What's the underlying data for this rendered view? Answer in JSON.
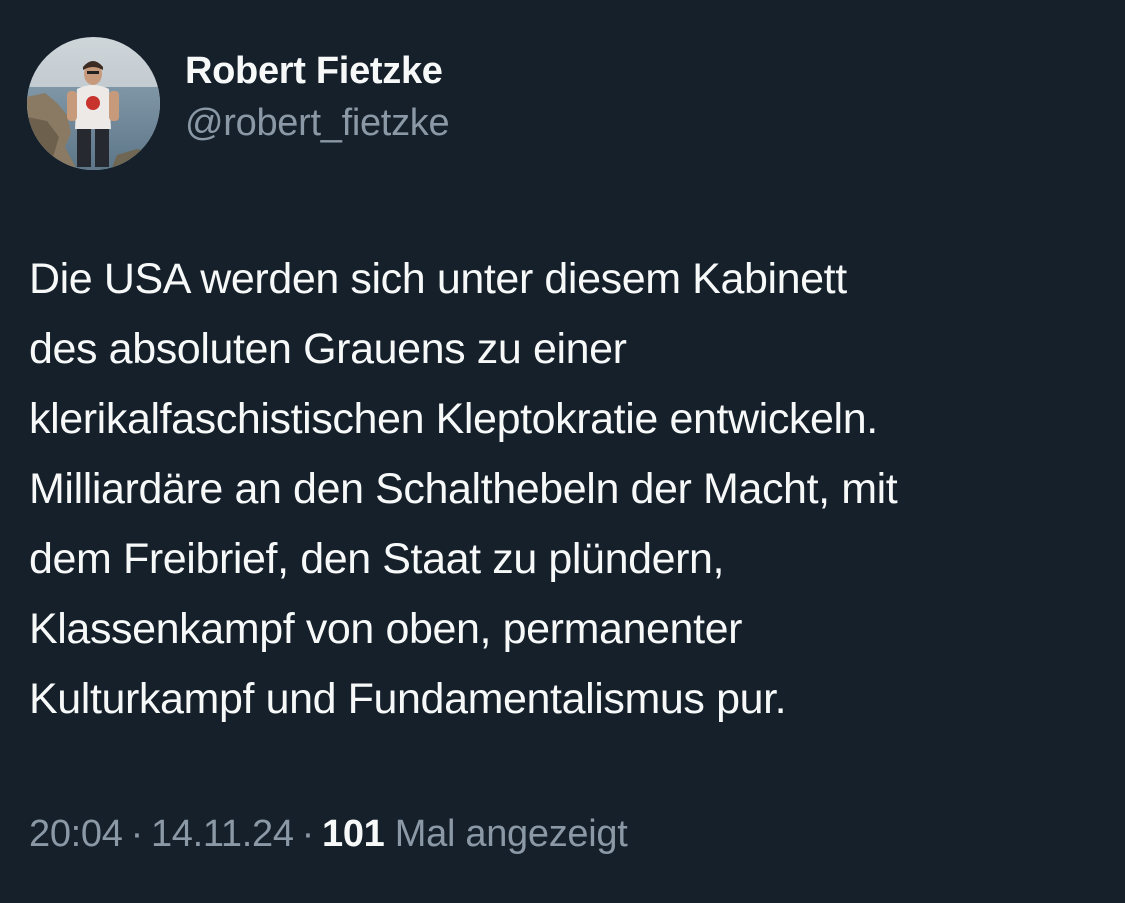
{
  "author": {
    "display_name": "Robert Fietzke",
    "handle": "@robert_fietzke",
    "avatar_icon": "profile-photo"
  },
  "tweet": {
    "lines": [
      "Die USA werden sich unter diesem Kabinett",
      "des absoluten Grauens zu einer",
      "klerikalfaschistischen Kleptokratie entwickeln.",
      "Milliardäre an den Schalthebeln der Macht, mit",
      "dem Freibrief, den Staat zu plündern,",
      "Klassenkampf von oben, permanenter",
      "Kulturkampf und Fundamentalismus pur."
    ]
  },
  "meta": {
    "time": "20:04",
    "separator": "·",
    "date": "14.11.24",
    "views_count": "101",
    "views_label": "Mal angezeigt"
  },
  "colors": {
    "background": "#15202b",
    "primary_text": "#f7f9f9",
    "secondary_text": "#8b98a5"
  }
}
